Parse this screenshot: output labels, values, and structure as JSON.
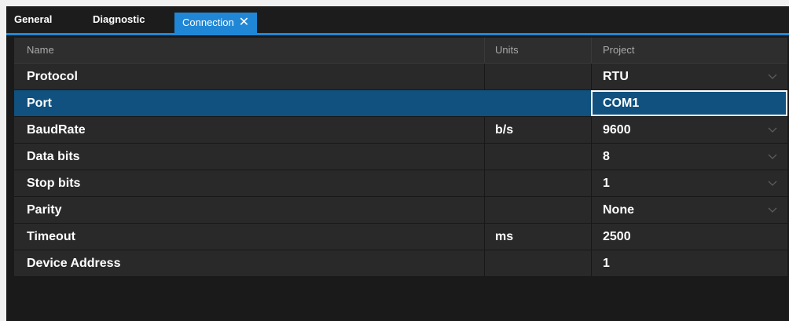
{
  "tabs": {
    "general": "General",
    "diagnostic": "Diagnostic",
    "connection": "Connection",
    "close_glyph": "✕"
  },
  "columns": {
    "name": "Name",
    "units": "Units",
    "project": "Project"
  },
  "rows": [
    {
      "name": "Protocol",
      "units": "",
      "value": "RTU",
      "dropdown": true
    },
    {
      "name": "Port",
      "units": "",
      "value": "COM1",
      "dropdown": false,
      "selected": true
    },
    {
      "name": "BaudRate",
      "units": "b/s",
      "value": "9600",
      "dropdown": true
    },
    {
      "name": "Data bits",
      "units": "",
      "value": "8",
      "dropdown": true
    },
    {
      "name": "Stop bits",
      "units": "",
      "value": "1",
      "dropdown": true
    },
    {
      "name": "Parity",
      "units": "",
      "value": "None",
      "dropdown": true
    },
    {
      "name": "Timeout",
      "units": "ms",
      "value": "2500",
      "dropdown": false
    },
    {
      "name": "Device Address",
      "units": "",
      "value": "1",
      "dropdown": false
    }
  ],
  "colors": {
    "accent": "#2087d6",
    "selected_row": "#10517f",
    "row_bg": "#292929",
    "header_bg": "#2e2e2e"
  }
}
